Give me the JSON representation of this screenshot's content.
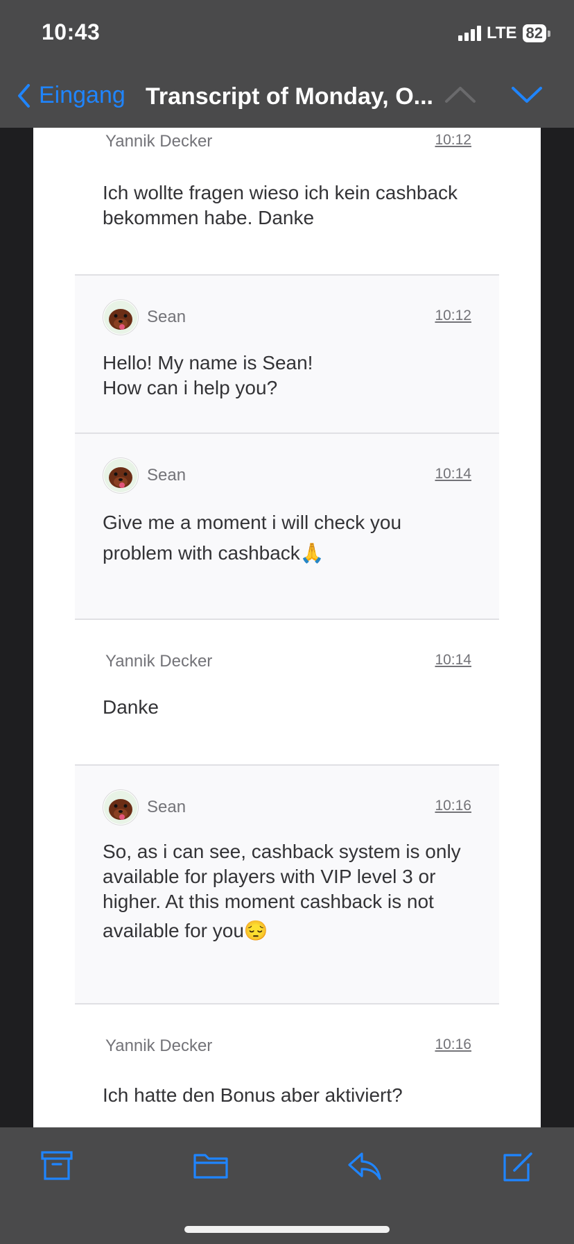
{
  "status": {
    "time": "10:43",
    "network": "LTE",
    "battery": "82"
  },
  "nav": {
    "back_label": "Eingang",
    "title": "Transcript of Monday, O..."
  },
  "messages": [
    {
      "sender": "Yannik Decker",
      "time": "10:12",
      "lines": [
        "Ich wollte fragen wieso ich kein cashback",
        "bekommen habe. Danke"
      ]
    },
    {
      "sender": "Sean",
      "time": "10:12",
      "lines": [
        "Hello! My name is Sean!",
        "How can i help you?"
      ]
    },
    {
      "sender": "Sean",
      "time": "10:14",
      "lines": [
        "Give me a moment i will check you",
        "problem with cashback🙏"
      ]
    },
    {
      "sender": "Yannik Decker",
      "time": "10:14",
      "lines": [
        "Danke"
      ]
    },
    {
      "sender": "Sean",
      "time": "10:16",
      "lines": [
        "So, as i can see, cashback system is only",
        "available for players with VIP level 3 or",
        "higher. At this moment cashback is not",
        "available for you😔"
      ]
    },
    {
      "sender": "Yannik Decker",
      "time": "10:16",
      "lines": [
        "Ich hatte den Bonus aber aktiviert?"
      ]
    }
  ],
  "toolbar": {
    "icons": [
      "archive-icon",
      "folder-icon",
      "reply-icon",
      "compose-icon"
    ]
  },
  "colors": {
    "accent": "#1f85ff",
    "bar": "#4a4a4b",
    "agent_bg": "#f9f9fb"
  }
}
